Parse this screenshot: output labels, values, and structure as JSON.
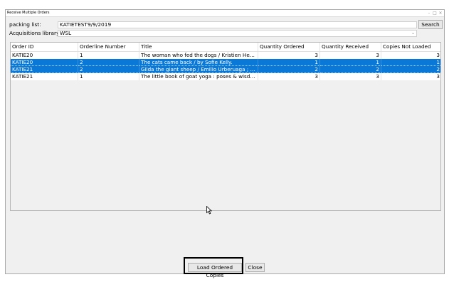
{
  "window": {
    "title": "Receive Multiple Orders"
  },
  "form": {
    "packing_list_label": "packing list:",
    "packing_list_value": "KATIETEST9/9/2019",
    "search_label": "Search",
    "library_label": "Acquisitions library:",
    "library_value": "WSL"
  },
  "grid": {
    "columns": [
      "Order ID",
      "Orderline Number",
      "Title",
      "Quantity Ordered",
      "Quantity Received",
      "Copies Not Loaded"
    ],
    "rows": [
      {
        "order_id": "KATIE20",
        "orderline": "1",
        "title": "The woman who fed the dogs / Kristien Hem...",
        "qty_ordered": "3",
        "qty_received": "3",
        "copies_not_loaded": "3",
        "selected": false
      },
      {
        "order_id": "KATIE20",
        "orderline": "2",
        "title": "The cats came back / by Sofie Kelly.",
        "qty_ordered": "1",
        "qty_received": "1",
        "copies_not_loaded": "1",
        "selected": true
      },
      {
        "order_id": "KATIE21",
        "orderline": "2",
        "title": "Gilda the giant sheep / Emilio Urberuaga ; En...",
        "qty_ordered": "2",
        "qty_received": "2",
        "copies_not_loaded": "2",
        "selected": true
      },
      {
        "order_id": "KATIE21",
        "orderline": "1",
        "title": "The little book of goat yoga : poses & wisdo...",
        "qty_ordered": "3",
        "qty_received": "3",
        "copies_not_loaded": "3",
        "selected": false
      }
    ]
  },
  "actions": {
    "load_label": "Load Ordered Copies",
    "close_label": "Close"
  }
}
